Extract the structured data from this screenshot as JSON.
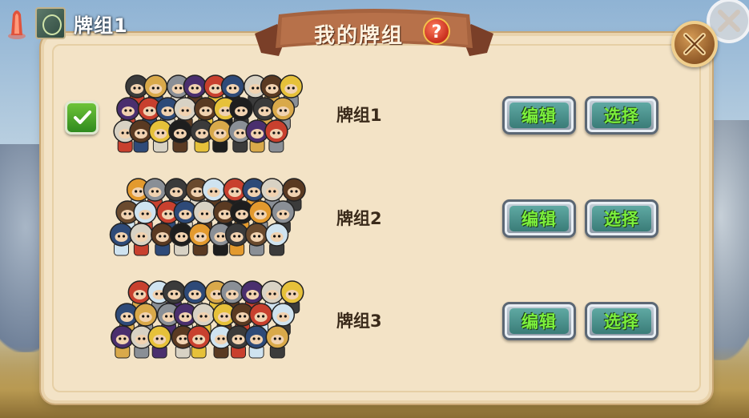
{
  "hud": {
    "crystal_icon": "red-crystal-icon",
    "deck_icon": "deck-emblem-icon",
    "current_deck": "牌组1"
  },
  "dialog": {
    "title": "我的牌组",
    "help_icon": "?",
    "close_icon": "close-icon"
  },
  "decks": [
    {
      "name": "牌组1",
      "selected": true,
      "edit_label": "编辑",
      "select_label": "选择"
    },
    {
      "name": "牌组2",
      "selected": false,
      "edit_label": "编辑",
      "select_label": "选择"
    },
    {
      "name": "牌组3",
      "selected": false,
      "edit_label": "编辑",
      "select_label": "选择"
    }
  ],
  "colors": {
    "panel": "#f3e3c6",
    "ribbon": "#9a5a3a",
    "button_text": "#7cf03c",
    "check_green": "#4caf2a"
  }
}
